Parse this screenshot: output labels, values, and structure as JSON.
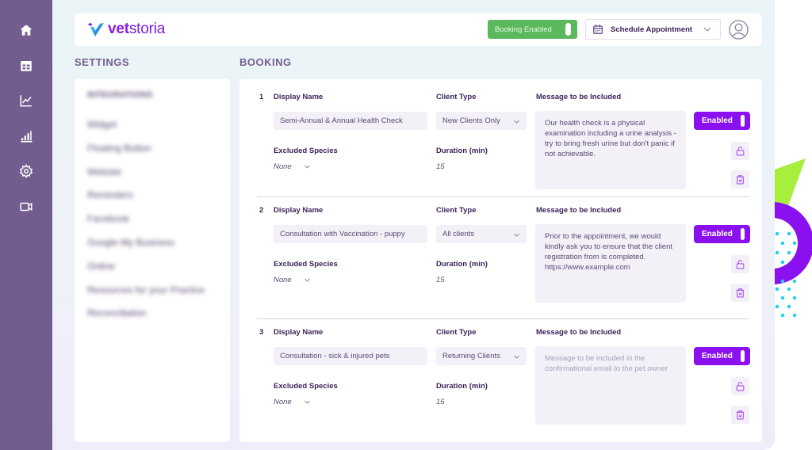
{
  "app": {
    "name": "vetstoria",
    "logo_bold": "vet",
    "logo_rest": "storia"
  },
  "colors": {
    "rail": "#735d8e",
    "accent": "#8a10f0",
    "booking_enabled": "#5cb85c",
    "deco_green": "#a8ee3c",
    "deco_purple": "#8a10f0",
    "deco_cyan": "#1ad0f0"
  },
  "rail": {
    "items": [
      {
        "icon": "home-icon"
      },
      {
        "icon": "calendar-icon"
      },
      {
        "icon": "line-chart-icon"
      },
      {
        "icon": "bar-chart-icon"
      },
      {
        "icon": "gear-icon"
      },
      {
        "icon": "video-icon"
      }
    ]
  },
  "header": {
    "booking_toggle_label": "Booking Enabled",
    "booking_enabled": true,
    "schedule_label": "Schedule Appointment",
    "schedule_icon": "calendar-icon",
    "avatar_icon": "user-icon"
  },
  "settings": {
    "title": "SETTINGS",
    "items": [
      "INTEGRATIONS",
      "Widget",
      "Floating Button",
      "Website",
      "Reminders",
      "Facebook",
      "Google My Business",
      "Online",
      "Resources for your Practice",
      "Reconciliation"
    ]
  },
  "booking": {
    "title": "BOOKING",
    "labels": {
      "display_name": "Display Name",
      "client_type": "Client Type",
      "message": "Message to be Included",
      "excluded_species": "Excluded Species",
      "duration": "Duration (min)",
      "enabled": "Enabled"
    },
    "rows": [
      {
        "number": "1",
        "display_name": "Semi-Annual & Annual Health Check",
        "client_type": "New Clients Only",
        "excluded_species": "None",
        "duration": "15",
        "message": "Our health check is a physical examination including a urine analysis - try to bring fresh urine but don't panic if not achievable.",
        "message_placeholder": "",
        "enabled": true
      },
      {
        "number": "2",
        "display_name": "Consultation with Vaccination - puppy",
        "client_type": "All clients",
        "excluded_species": "None",
        "duration": "15",
        "message": "Prior to the appointment, we would kindly ask you to ensure that the client registration from is completed.\nhttps://www.example.com",
        "message_placeholder": "",
        "enabled": true
      },
      {
        "number": "3",
        "display_name": "Consultation - sick & injured pets",
        "client_type": "Returning Clients",
        "excluded_species": "None",
        "duration": "15",
        "message": "",
        "message_placeholder": "Message to be included in the confirmational email to the pet owner",
        "enabled": true
      }
    ]
  }
}
